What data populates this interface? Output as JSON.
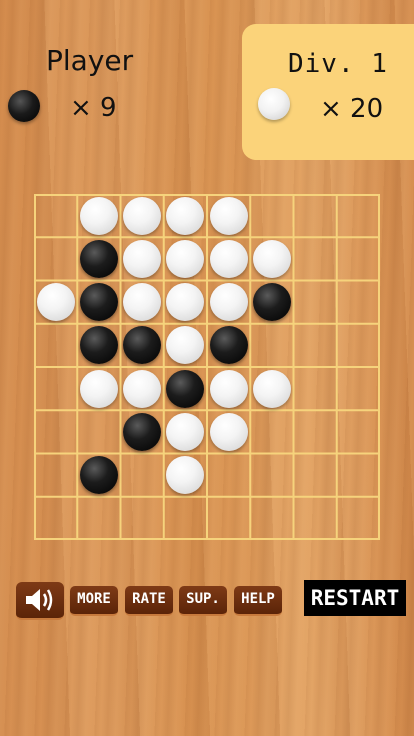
{
  "player": {
    "label": "Player",
    "count_text": "× 9",
    "stone": "black"
  },
  "opponent": {
    "label": "Div. 1",
    "count_text": "× 20",
    "stone": "white"
  },
  "colors": {
    "board_line": "#f6d37c",
    "panel": "#fbd37a",
    "button": "#6b2d0e"
  },
  "board": {
    "size": 8,
    "stones": [
      {
        "row": 0,
        "col": 1,
        "color": "white"
      },
      {
        "row": 0,
        "col": 2,
        "color": "white"
      },
      {
        "row": 0,
        "col": 3,
        "color": "white"
      },
      {
        "row": 0,
        "col": 4,
        "color": "white"
      },
      {
        "row": 1,
        "col": 1,
        "color": "black"
      },
      {
        "row": 1,
        "col": 2,
        "color": "white"
      },
      {
        "row": 1,
        "col": 3,
        "color": "white"
      },
      {
        "row": 1,
        "col": 4,
        "color": "white"
      },
      {
        "row": 1,
        "col": 5,
        "color": "white"
      },
      {
        "row": 2,
        "col": 0,
        "color": "white"
      },
      {
        "row": 2,
        "col": 1,
        "color": "black"
      },
      {
        "row": 2,
        "col": 2,
        "color": "white"
      },
      {
        "row": 2,
        "col": 3,
        "color": "white"
      },
      {
        "row": 2,
        "col": 4,
        "color": "white"
      },
      {
        "row": 2,
        "col": 5,
        "color": "black"
      },
      {
        "row": 3,
        "col": 1,
        "color": "black"
      },
      {
        "row": 3,
        "col": 2,
        "color": "black"
      },
      {
        "row": 3,
        "col": 3,
        "color": "white"
      },
      {
        "row": 3,
        "col": 4,
        "color": "black"
      },
      {
        "row": 4,
        "col": 1,
        "color": "white"
      },
      {
        "row": 4,
        "col": 2,
        "color": "white"
      },
      {
        "row": 4,
        "col": 3,
        "color": "black"
      },
      {
        "row": 4,
        "col": 4,
        "color": "white"
      },
      {
        "row": 4,
        "col": 5,
        "color": "white"
      },
      {
        "row": 5,
        "col": 2,
        "color": "black"
      },
      {
        "row": 5,
        "col": 3,
        "color": "white"
      },
      {
        "row": 5,
        "col": 4,
        "color": "white"
      },
      {
        "row": 6,
        "col": 1,
        "color": "black"
      },
      {
        "row": 6,
        "col": 3,
        "color": "white"
      }
    ]
  },
  "toolbar": {
    "sound_icon": "speaker-icon",
    "more": "MORE",
    "rate": "RATE",
    "sup": "SUP.",
    "help": "HELP",
    "restart": "RESTART"
  }
}
